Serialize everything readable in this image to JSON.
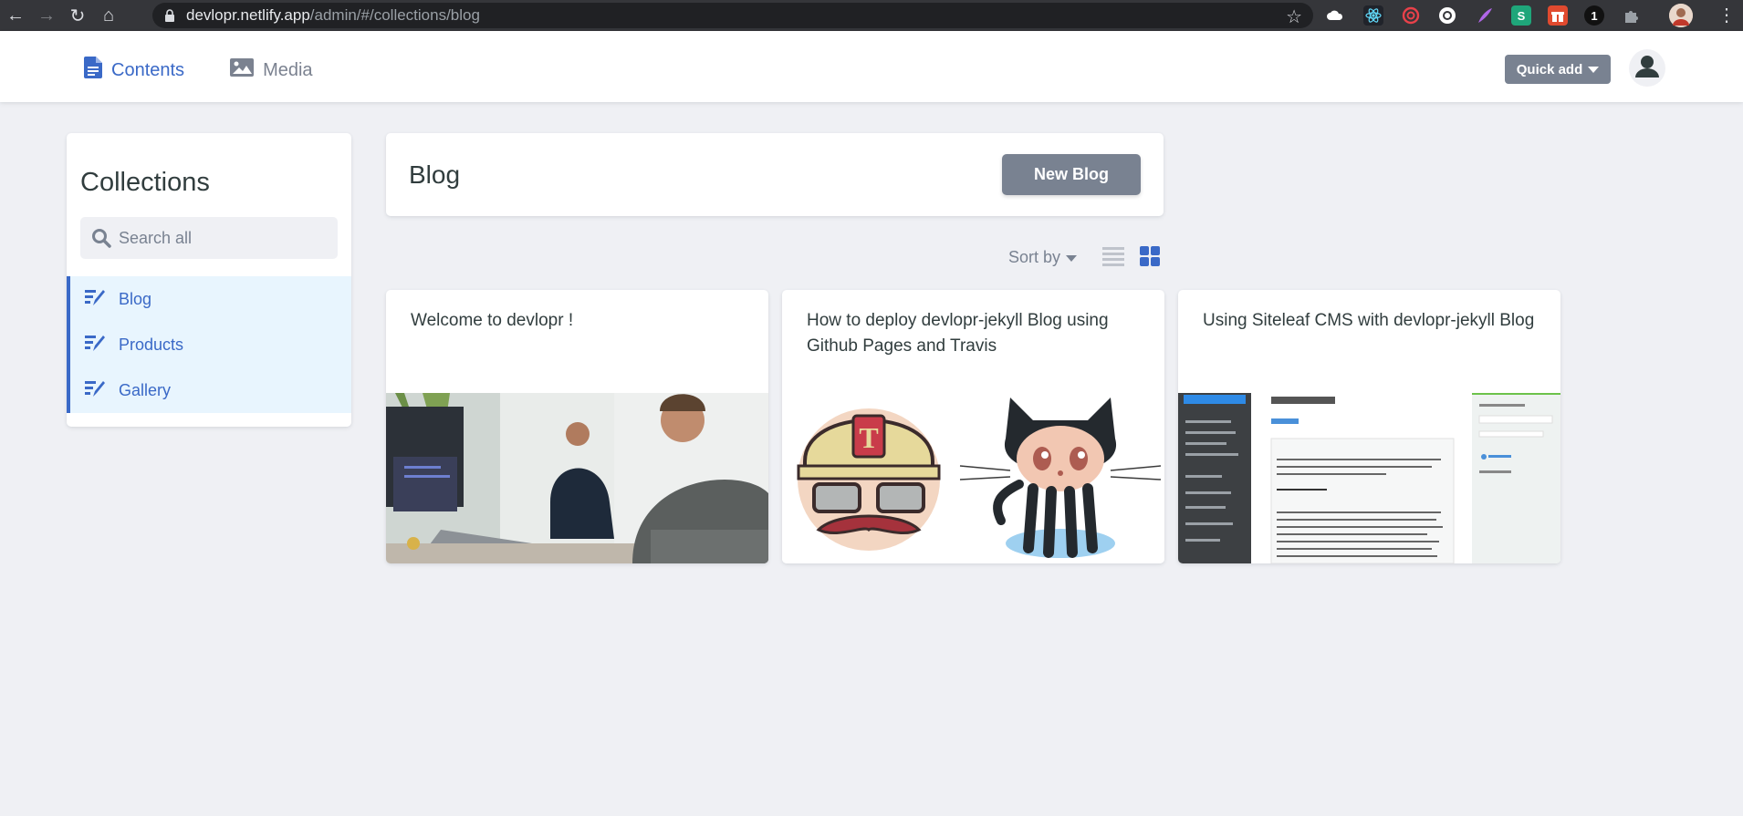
{
  "browser": {
    "url_host": "devlopr.netlify.app",
    "url_path": "/admin/#/collections/blog"
  },
  "header": {
    "nav": [
      {
        "label": "Contents",
        "icon": "document-icon",
        "active": true
      },
      {
        "label": "Media",
        "icon": "image-icon",
        "active": false
      }
    ],
    "quick_add_label": "Quick add"
  },
  "sidebar": {
    "title": "Collections",
    "search_placeholder": "Search all",
    "items": [
      {
        "label": "Blog",
        "icon": "write-icon"
      },
      {
        "label": "Products",
        "icon": "write-icon"
      },
      {
        "label": "Gallery",
        "icon": "write-icon"
      }
    ]
  },
  "main": {
    "collection_title": "Blog",
    "new_button_label": "New Blog",
    "sort_label": "Sort by",
    "entries": [
      {
        "title": "Welcome to devlopr !",
        "image": "office-photo"
      },
      {
        "title": "How to deploy devlopr-jekyll Blog using Github Pages and Travis",
        "image": "travis-octocat"
      },
      {
        "title": "Using Siteleaf CMS with devlopr-jekyll Blog",
        "image": "siteleaf-screenshot"
      }
    ]
  },
  "colors": {
    "accent": "#3a69c7",
    "button_gray": "#798291",
    "page_bg": "#eff0f4",
    "active_item_bg": "#e8f5fe"
  }
}
